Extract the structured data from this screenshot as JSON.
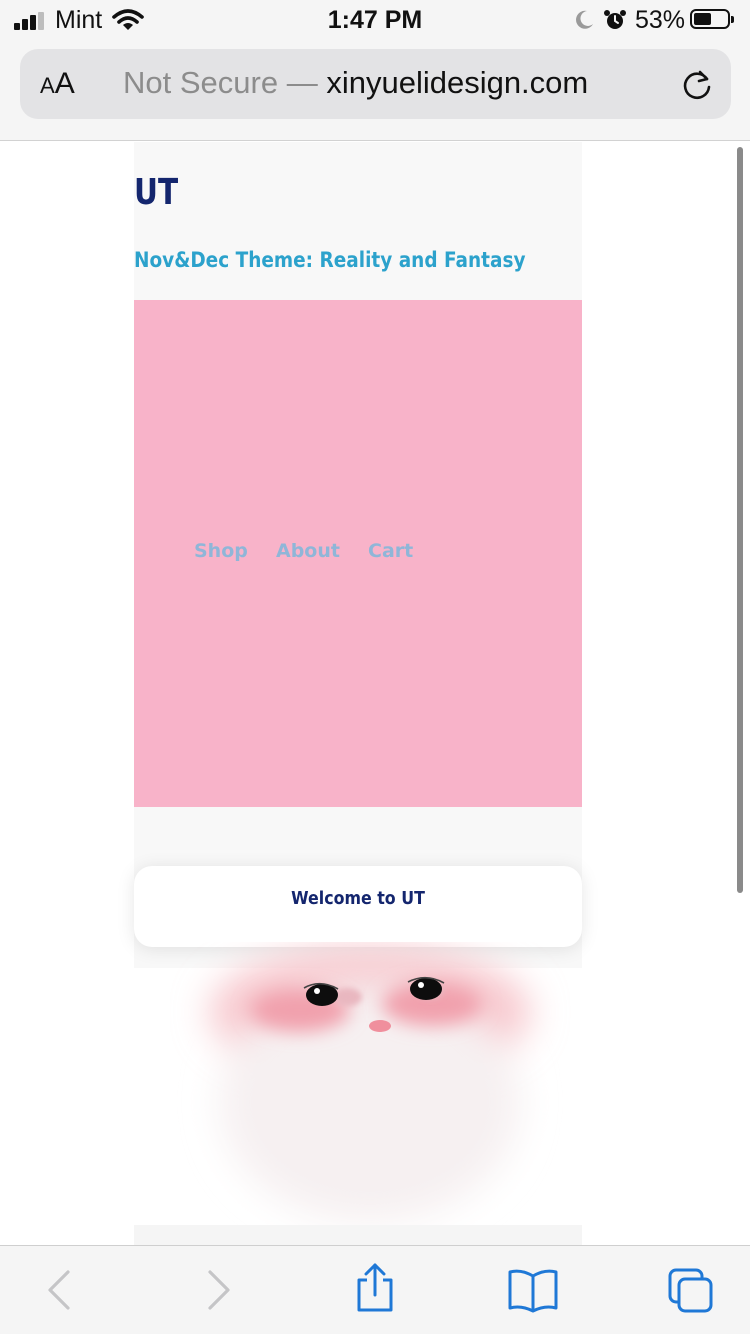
{
  "status_bar": {
    "carrier": "Mint",
    "time": "1:47 PM",
    "battery_percent": "53%",
    "battery_level": 0.53
  },
  "address_bar": {
    "text_size_small": "A",
    "text_size_large": "A",
    "security_label": "Not Secure —",
    "domain": "xinyuelidesign.com"
  },
  "site": {
    "logo": "UT",
    "theme": "Nov&Dec Theme: Reality and Fantasy",
    "nav": [
      "Shop",
      "About",
      "Cart"
    ],
    "welcome": "Welcome to UT"
  },
  "colors": {
    "hero_background": "#f8b3c9",
    "logo": "#14266e",
    "theme_text": "#2ca2cc",
    "nav_link": "#8fb6d8",
    "toolbar_icon": "#1f78d6"
  },
  "toolbar": {
    "icons": [
      "back-icon",
      "forward-icon",
      "share-icon",
      "bookmarks-icon",
      "tabs-icon"
    ]
  }
}
